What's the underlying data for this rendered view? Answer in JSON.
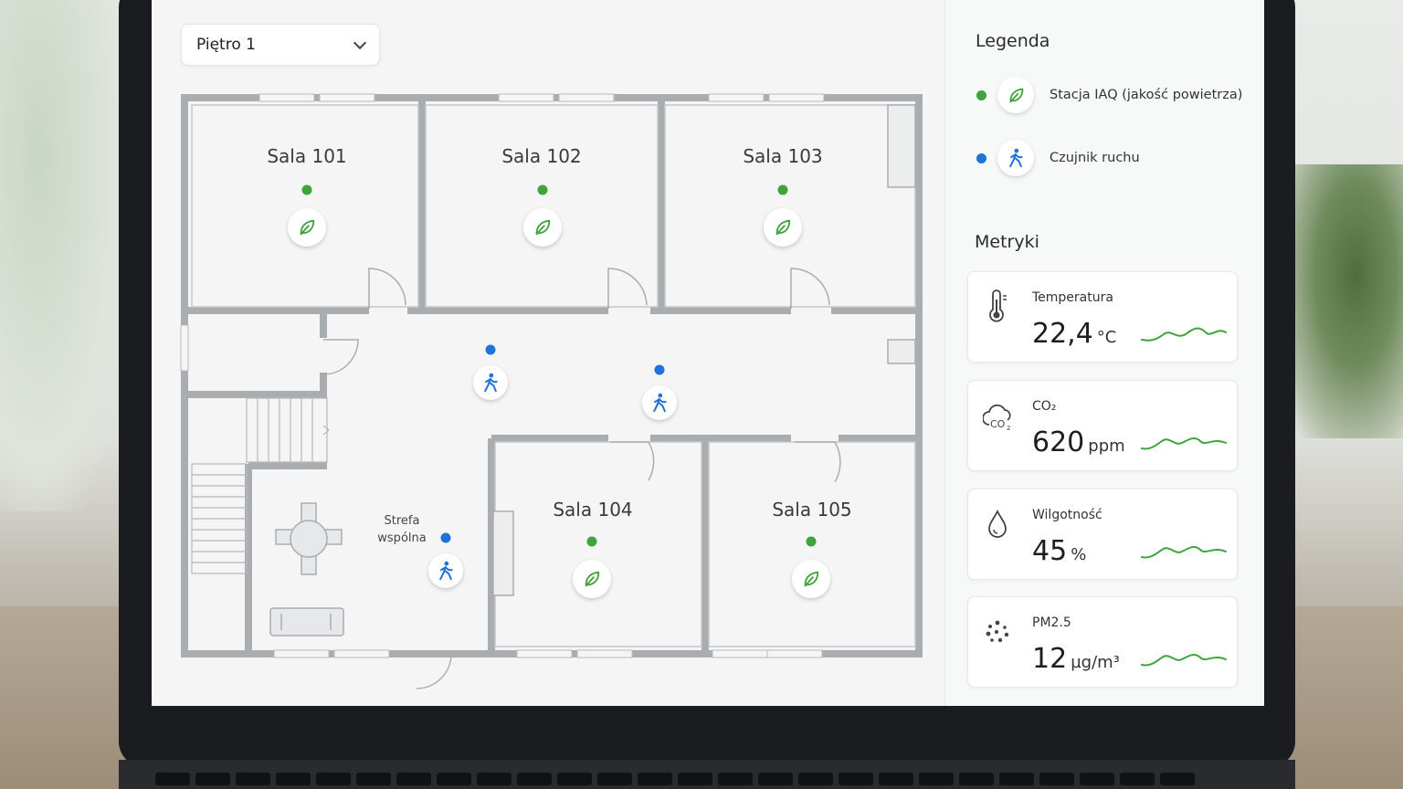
{
  "floor_select": {
    "value": "Piętro 1"
  },
  "rooms": [
    {
      "label": "Sala 101"
    },
    {
      "label": "Sala 102"
    },
    {
      "label": "Sala 103"
    },
    {
      "label": "Sala 104"
    },
    {
      "label": "Sala 105"
    }
  ],
  "common_zone": {
    "line1": "Strefa",
    "line2": "wspólna"
  },
  "legend": {
    "title": "Legenda",
    "items": [
      {
        "label": "Stacja IAQ (jakość powietrza)",
        "color": "#3fa43c",
        "icon": "leaf-icon"
      },
      {
        "label": "Czujnik ruchu",
        "color": "#1f74d6",
        "icon": "walking-person-icon"
      }
    ]
  },
  "metrics": {
    "title": "Metryki",
    "items": [
      {
        "label": "Temperatura",
        "value": "22,4",
        "unit": "°C",
        "icon": "thermometer-icon"
      },
      {
        "label": "CO₂",
        "value": "620",
        "unit": "ppm",
        "icon": "co2-cloud-icon"
      },
      {
        "label": "Wilgotność",
        "value": "45",
        "unit": "%",
        "icon": "droplet-icon"
      },
      {
        "label": "PM2.5",
        "value": "12",
        "unit": "µg/m³",
        "icon": "particles-icon"
      }
    ],
    "sparkline_color": "#3fa43c"
  }
}
